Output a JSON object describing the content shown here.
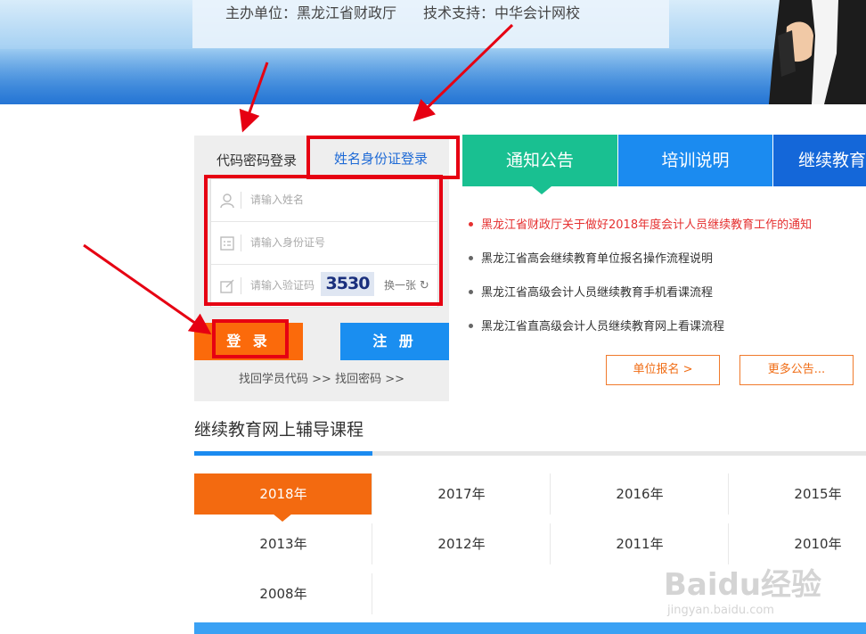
{
  "header": {
    "host": "主办单位：黑龙江省财政厅",
    "support": "技术支持：中华会计网校"
  },
  "login": {
    "tab_code": "代码密码登录",
    "tab_name": "姓名身份证登录",
    "name_placeholder": "请输入姓名",
    "id_placeholder": "请输入身份证号",
    "captcha_placeholder": "请输入验证码",
    "captcha_code": "3530",
    "captcha_refresh": "换一张",
    "login_button": "登 录",
    "register_button": "注 册",
    "recover_links": "找回学员代码 >> 找回密码 >>"
  },
  "notice": {
    "tabs": [
      "通知公告",
      "培训说明",
      "继续教育"
    ],
    "items": [
      "黑龙江省财政厅关于做好2018年度会计人员继续教育工作的通知",
      "黑龙江省高会继续教育单位报名操作流程说明",
      "黑龙江省高级会计人员继续教育手机看课流程",
      "黑龙江省直高级会计人员继续教育网上看课流程"
    ],
    "unit_signup": "单位报名 >",
    "more": "更多公告..."
  },
  "courses": {
    "title": "继续教育网上辅导课程",
    "years": [
      "2018年",
      "2017年",
      "2016年",
      "2015年",
      "2013年",
      "2012年",
      "2011年",
      "2010年",
      "2008年"
    ],
    "selected": "2018年"
  },
  "watermark": {
    "logo": "Baidu经验",
    "url": "jingyan.baidu.com"
  },
  "colors": {
    "green_tab": "#19c091",
    "blue_tab": "#1b8bf0",
    "orange": "#f36a10",
    "annotation_red": "#e60012"
  }
}
